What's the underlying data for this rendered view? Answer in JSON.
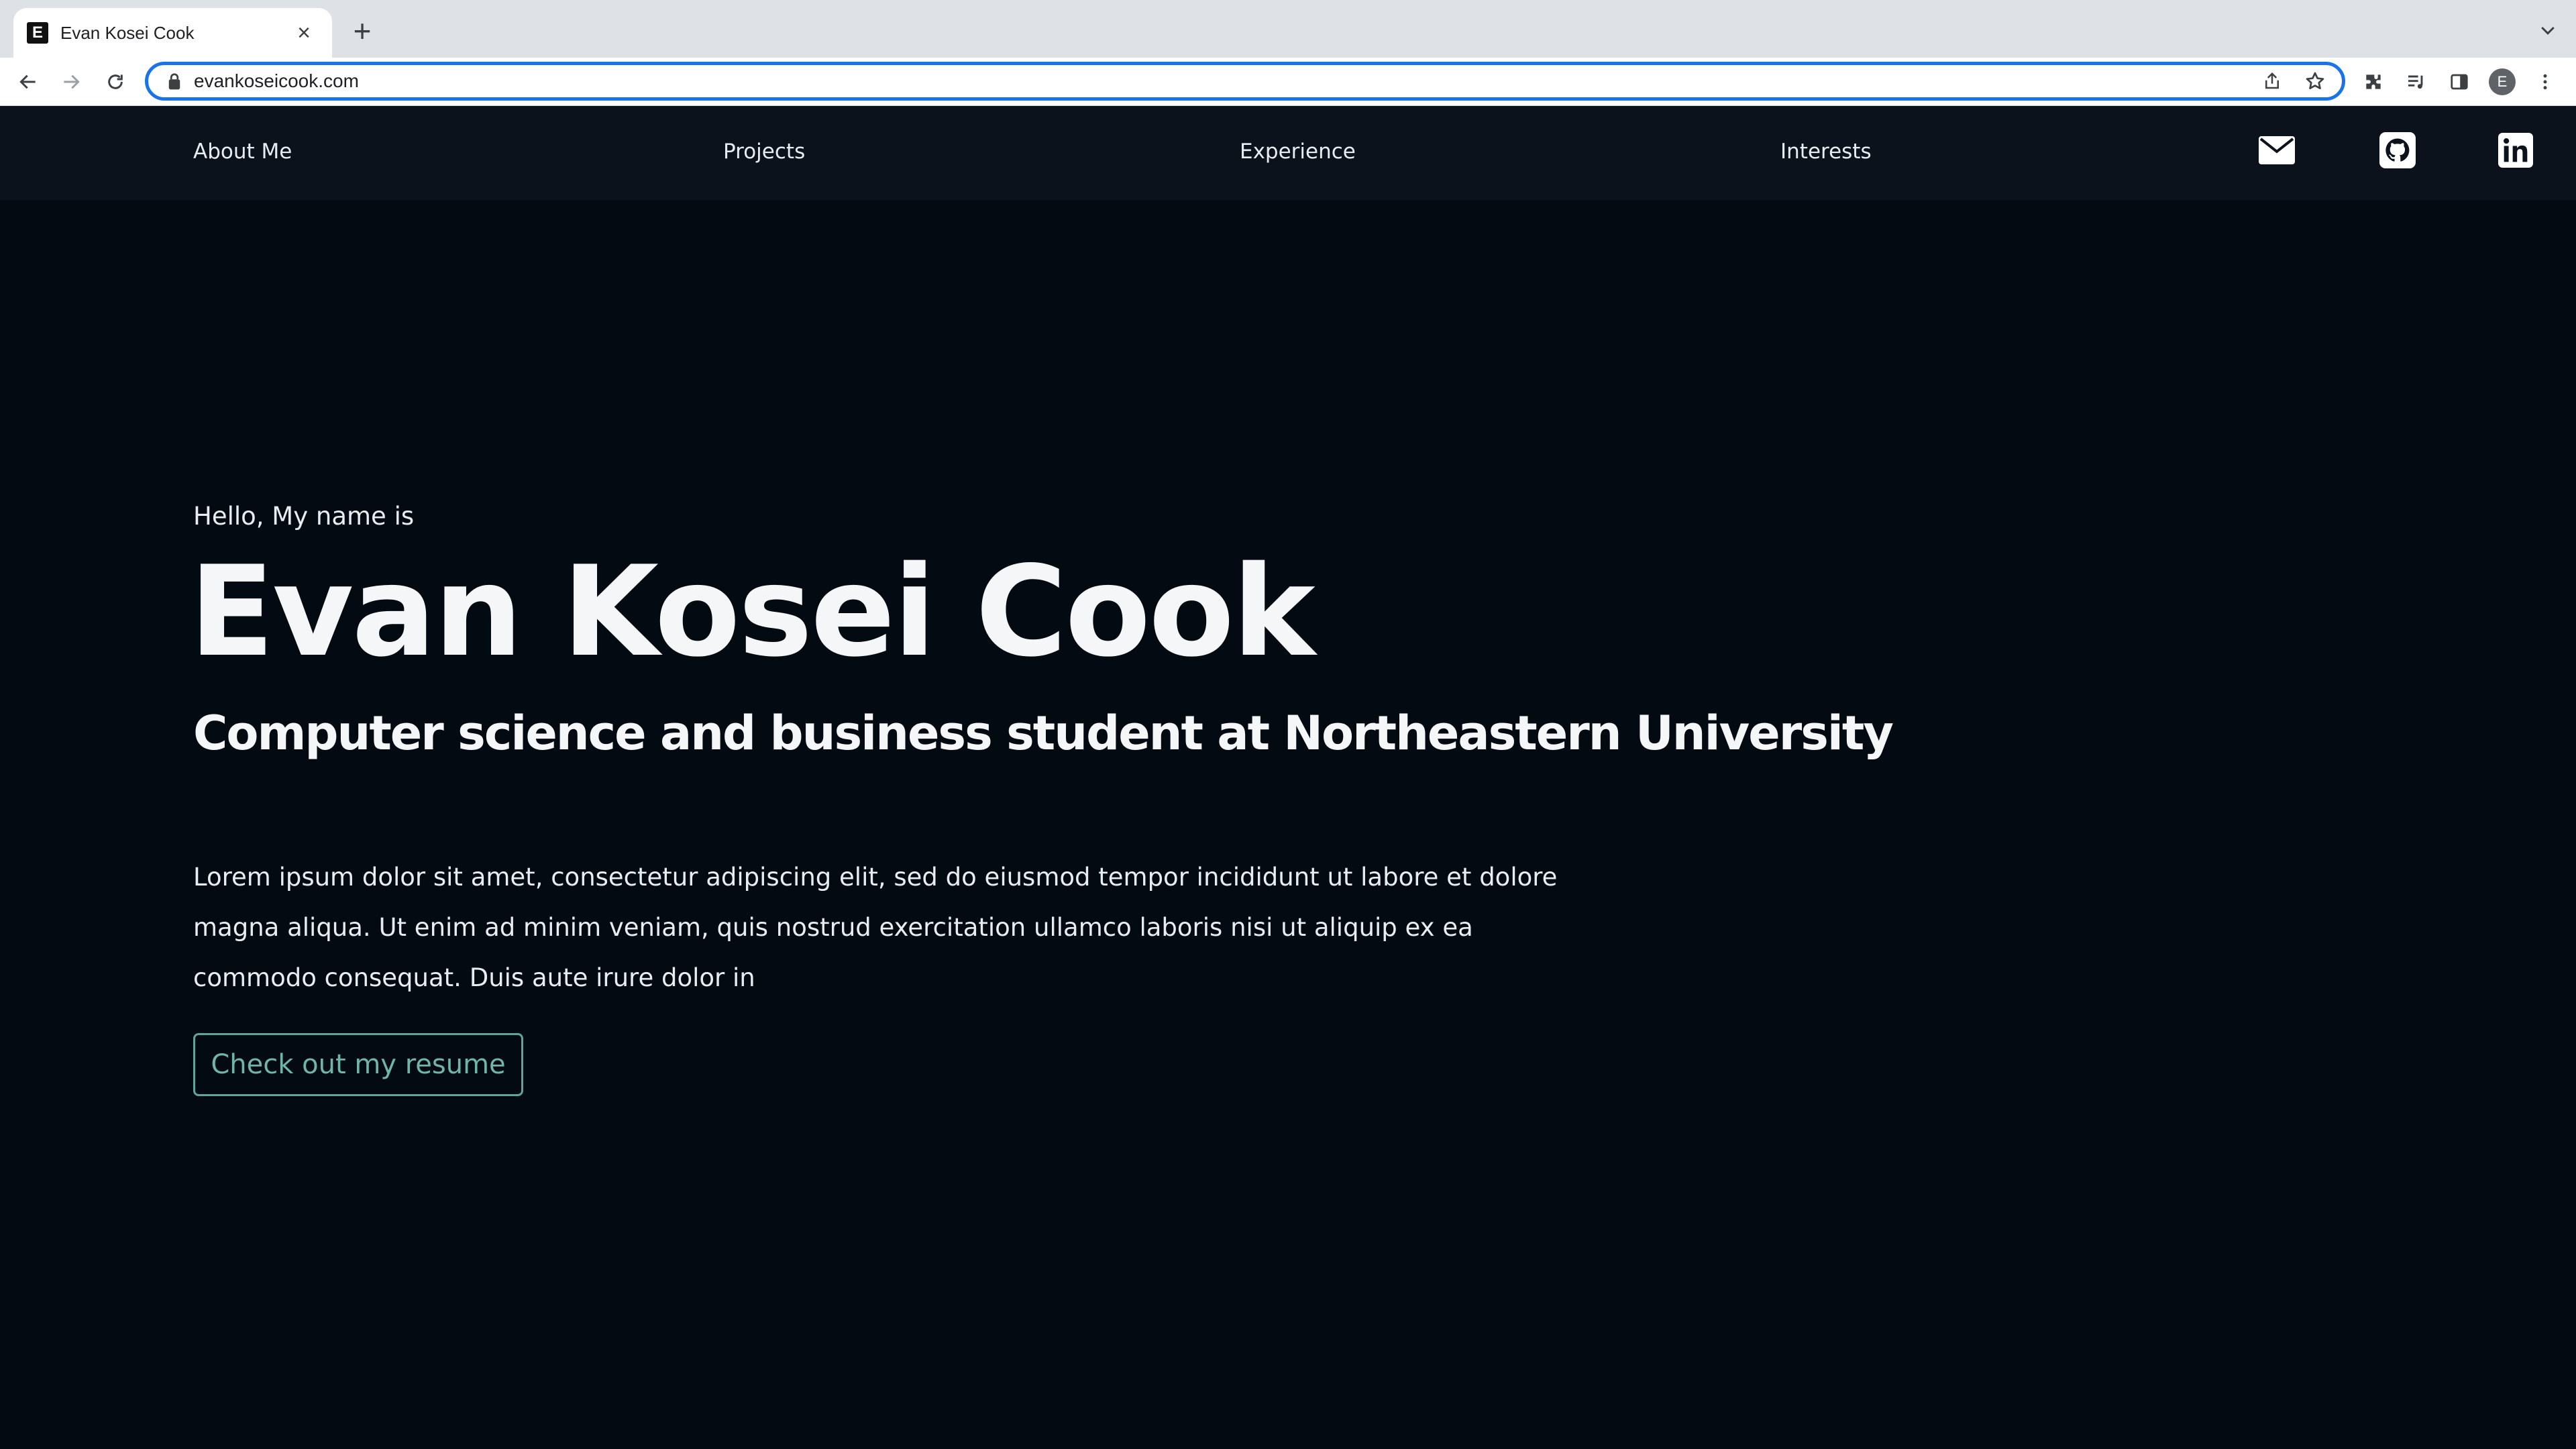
{
  "browser": {
    "tab_title": "Evan Kosei Cook",
    "tab_favicon_letter": "E",
    "url": "evankoseicook.com",
    "profile_initial": "E"
  },
  "nav": {
    "links": [
      {
        "label": "About Me"
      },
      {
        "label": "Projects"
      },
      {
        "label": "Experience"
      },
      {
        "label": "Interests"
      }
    ],
    "icons": [
      "email-icon",
      "github-icon",
      "linkedin-icon"
    ]
  },
  "hero": {
    "greeting": "Hello, My name is",
    "name": "Evan Kosei Cook",
    "tagline": "Computer science and business student at Northeastern University",
    "bio": "Lorem ipsum dolor sit amet, consectetur adipiscing elit, sed do eiusmod tempor incididunt ut labore et dolore magna aliqua. Ut enim ad minim veniam, quis nostrud exercitation ullamco laboris nisi ut aliquip ex ea commodo consequat. Duis aute irure dolor in",
    "resume_button": "Check out my resume"
  },
  "colors": {
    "page_background": "#040a12",
    "nav_background": "#0b121b",
    "accent": "#6fb5a8",
    "omnibox_focus": "#1a73e8"
  }
}
